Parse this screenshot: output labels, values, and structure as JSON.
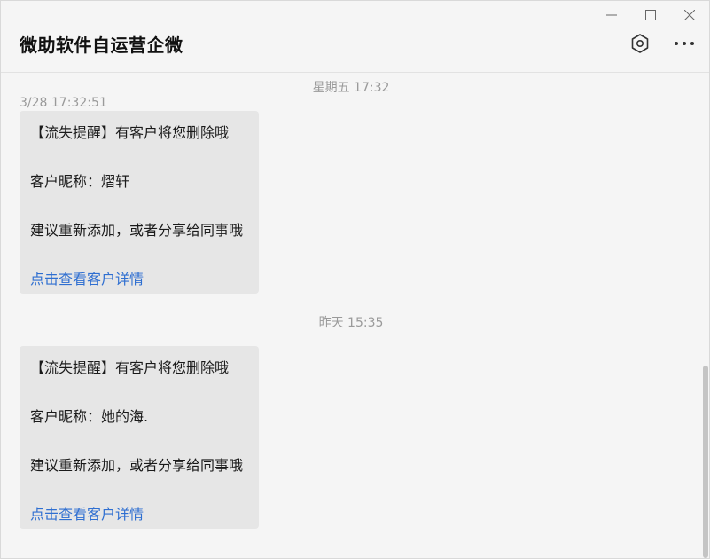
{
  "window": {
    "minimize_icon": "minimize-icon",
    "maximize_icon": "maximize-icon",
    "close_icon": "close-icon"
  },
  "header": {
    "title": "微助软件自运营企微",
    "settings_icon": "hexagon-settings-icon",
    "more_icon": "more-dots-icon"
  },
  "messages": [
    {
      "timestamp": "星期五 17:32",
      "sender_time": "3/28 17:32:51",
      "lines": [
        "【流失提醒】有客户将您删除哦",
        "客户昵称：熠轩",
        "建议重新添加，或者分享给同事哦"
      ],
      "link": "点击查看客户详情"
    },
    {
      "timestamp": "昨天 15:35",
      "lines": [
        "【流失提醒】有客户将您删除哦",
        "客户昵称：她的海.",
        "建议重新添加，或者分享给同事哦"
      ],
      "link": "点击查看客户详情"
    }
  ],
  "colors": {
    "background": "#f5f5f5",
    "bubble": "#e6e6e6",
    "link": "#2f6fd1",
    "muted_text": "#9a9a9a"
  }
}
